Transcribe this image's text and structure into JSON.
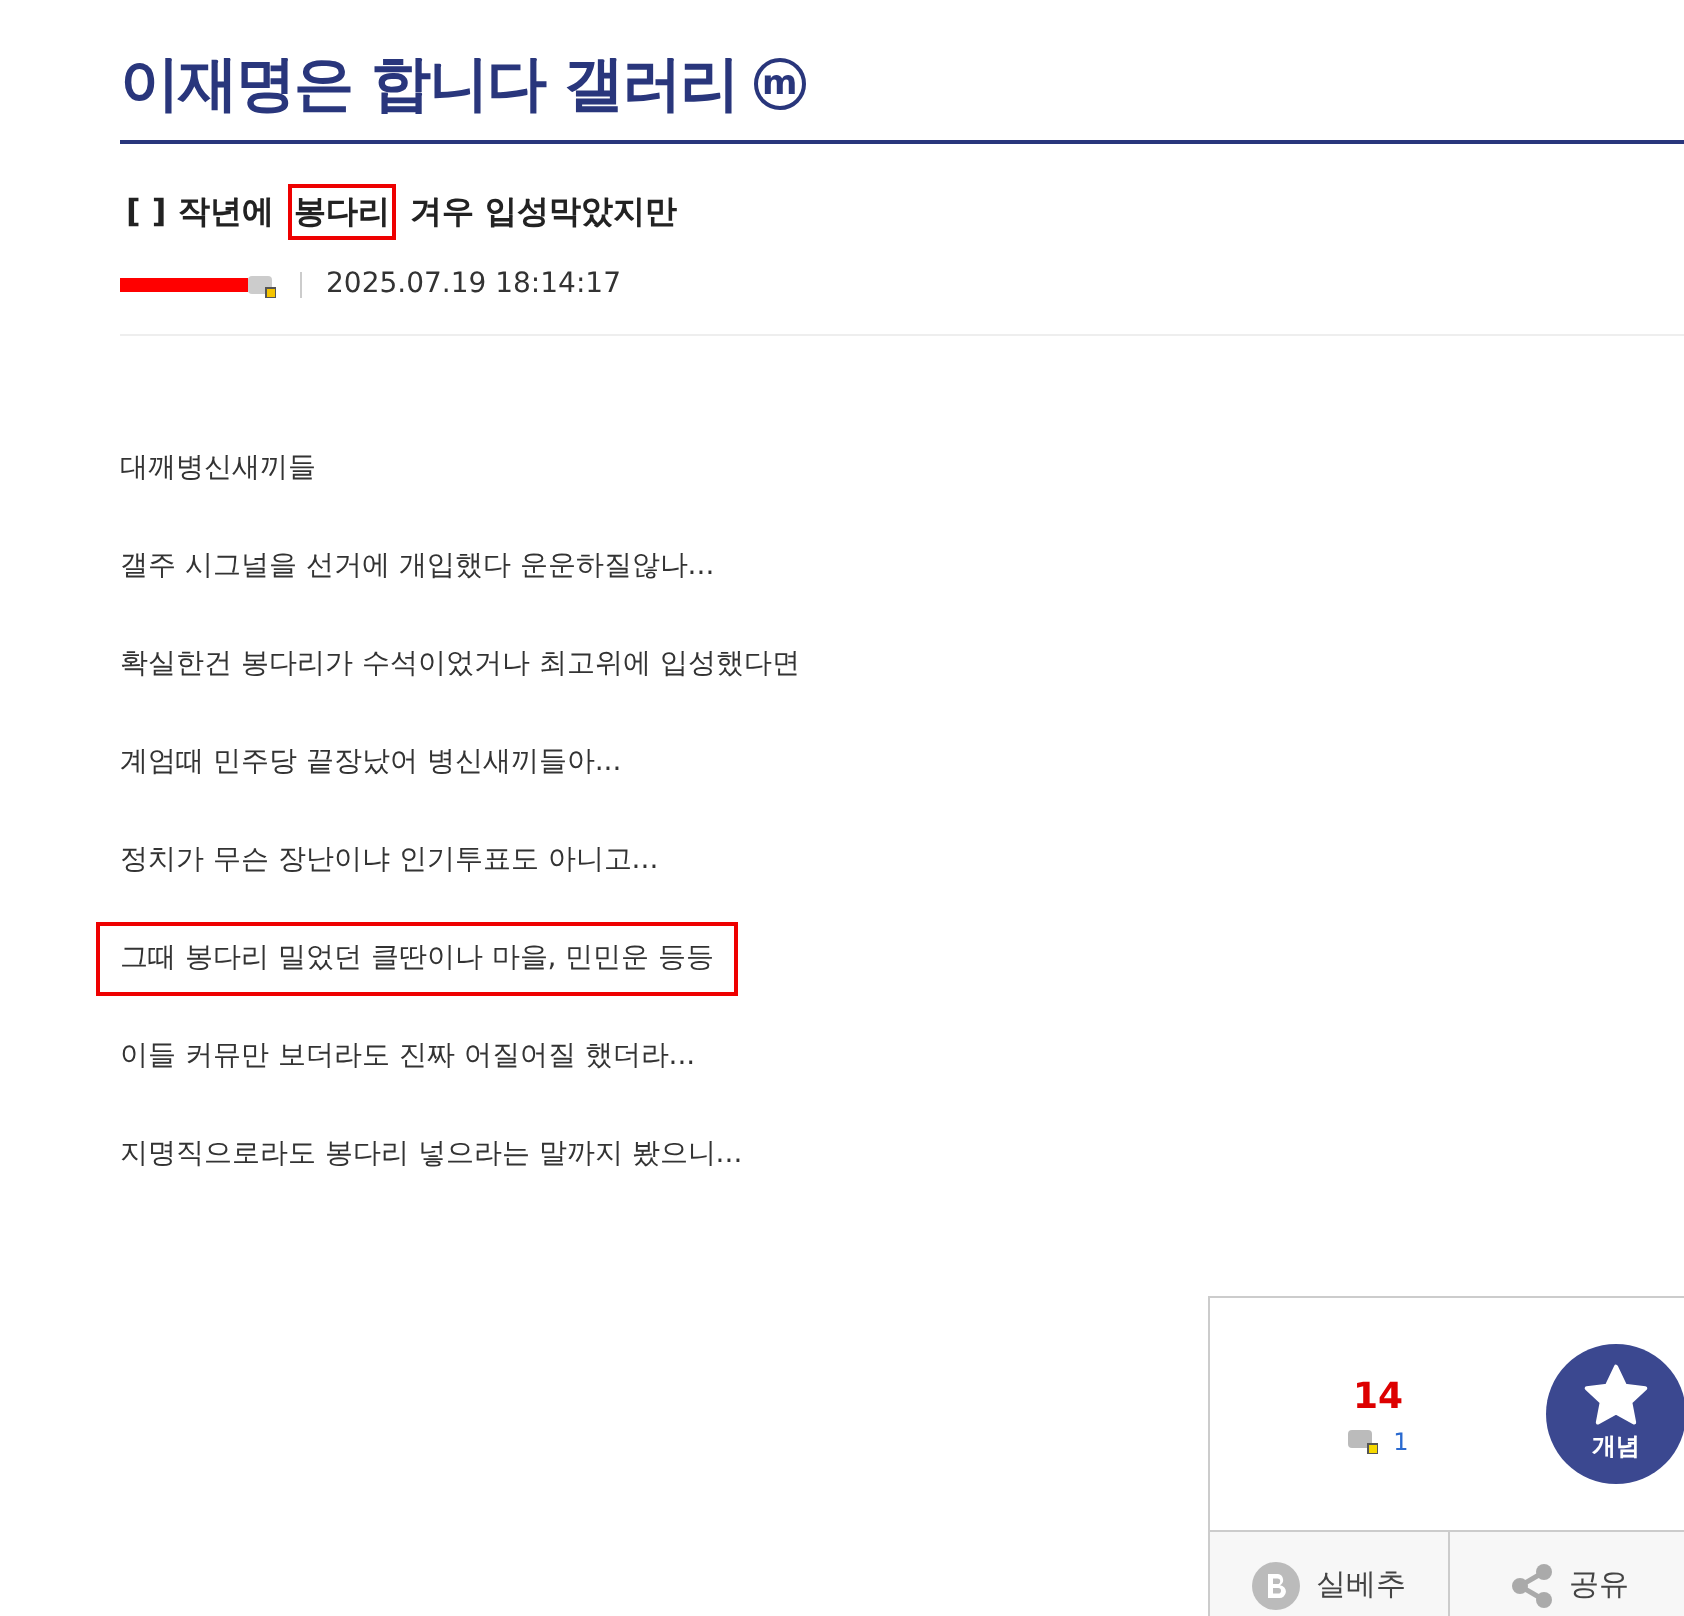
{
  "gallery": {
    "title": "이재명은 합니다 갤러리",
    "badge": "m"
  },
  "post": {
    "title_parts": [
      {
        "text": "[  ] 작년에",
        "highlighted": false
      },
      {
        "text": "봉다리",
        "highlighted": true
      },
      {
        "text": "겨우 입성막았지만",
        "highlighted": false
      }
    ],
    "author_redacted": true,
    "date": "2025.07.19 18:14:17",
    "body": [
      {
        "text": "대깨병신새끼들",
        "highlighted": false
      },
      {
        "text": "갤주 시그널을 선거에 개입했다 운운하질않나...",
        "highlighted": false
      },
      {
        "text": "확실한건 봉다리가 수석이었거나 최고위에 입성했다면",
        "highlighted": false
      },
      {
        "text": "계엄때 민주당 끝장났어 병신새끼들아...",
        "highlighted": false
      },
      {
        "text": "정치가 무슨 장난이냐 인기투표도 아니고...",
        "highlighted": false
      },
      {
        "text": "그때 봉다리 밀었던 클딴이나 마을, 민민운 등등",
        "highlighted": true
      },
      {
        "text": "이들 커뮤만 보더라도 진짜 어질어질 했더라...",
        "highlighted": false
      },
      {
        "text": "지명직으로라도 봉다리 넣으라는 말까지 봤으니...",
        "highlighted": false
      }
    ]
  },
  "recommend": {
    "count": "14",
    "fixed_count": "1",
    "button_label": "개념"
  },
  "actions": [
    {
      "kind": "best",
      "label": "실베추"
    },
    {
      "kind": "share",
      "label": "공유"
    }
  ]
}
